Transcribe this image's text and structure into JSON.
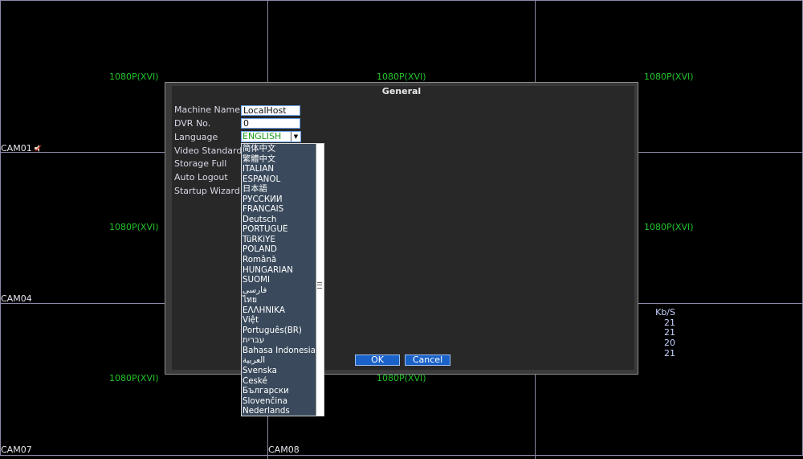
{
  "channels": {
    "resolution": "1080P(XVI)",
    "cam01": "CAM01",
    "cam04": "CAM04",
    "cam07": "CAM07",
    "cam08": "CAM08"
  },
  "bitrate": {
    "header": "Kb/S",
    "values": [
      "21",
      "21",
      "20",
      "21"
    ]
  },
  "dialog": {
    "title": "General",
    "labels": {
      "machine_name": "Machine Name",
      "dvr_no": "DVR No.",
      "language": "Language",
      "video_standard": "Video Standard",
      "storage_full": "Storage Full",
      "auto_logout": "Auto Logout",
      "startup_wizard": "Startup Wizard"
    },
    "values": {
      "machine_name": "LocalHost",
      "dvr_no": "0",
      "language": "ENGLISH"
    },
    "language_options": [
      "简体中文",
      "繁體中文",
      "ITALIAN",
      "ESPAÑOL",
      "日本語",
      "РУССКИЙ",
      "FRANCAIS",
      "Deutsch",
      "PORTUGUÊ",
      "TüRKiYE",
      "POLAND",
      "Română",
      "HUNGARIAN",
      "SUOMI",
      "فارسی",
      "ไทย",
      "ΕΛΛΗΝΙΚΑ",
      "Việt",
      "Português(BR)",
      "עברית",
      "Bahasa Indonesia",
      "العربية",
      "Svenska",
      "České",
      "Български",
      "Slovenčina",
      "Nederlands"
    ],
    "ok_label": "OK",
    "cancel_label": "Cancel"
  },
  "colors": {
    "resolution_text": "#22c42b",
    "button": "#1a62c8",
    "dropdown_bg": "#3a4a5c"
  }
}
